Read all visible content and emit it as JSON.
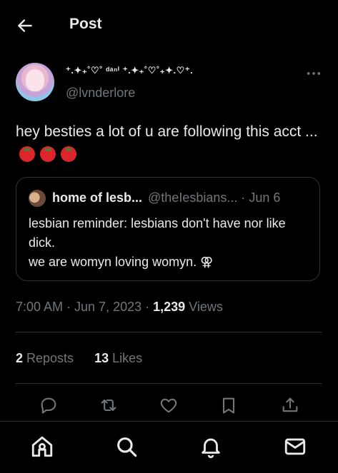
{
  "header": {
    "title": "Post",
    "back_icon": "arrow-left-icon"
  },
  "tweet": {
    "display_name": "⁺.✦₊˚♡˚ ᵈᵃⁿⁱ ⁺.✦₊˚♡˚₊✦.♡⁺.",
    "handle": "@lvnderlore",
    "text": "hey besties a lot of u are following this acct ...",
    "emoji": [
      "tomato",
      "tomato",
      "tomato"
    ],
    "timestamp": "7:00 AM · Jun 7, 2023",
    "separator": " · ",
    "views_count": "1,239",
    "views_label": " Views",
    "reposts_count": "2",
    "reposts_label": " Reposts",
    "likes_count": "13",
    "likes_label": " Likes"
  },
  "quote": {
    "name": "home of lesb...",
    "handle": "@theIesbians... · Jun 6",
    "line1": "lesbian reminder: lesbians don't have nor like dick.",
    "line2": "we are womyn loving womyn. ⚢"
  },
  "actions": [
    "reply-icon",
    "repost-icon",
    "like-icon",
    "bookmark-icon",
    "share-icon"
  ],
  "nav": [
    "home-icon",
    "search-icon",
    "notifications-icon",
    "messages-icon"
  ],
  "colors": {
    "background": "#000000",
    "text": "#e7e9ea",
    "secondary": "#71767b",
    "border": "#2f3336",
    "tomato": "#e0242b"
  }
}
